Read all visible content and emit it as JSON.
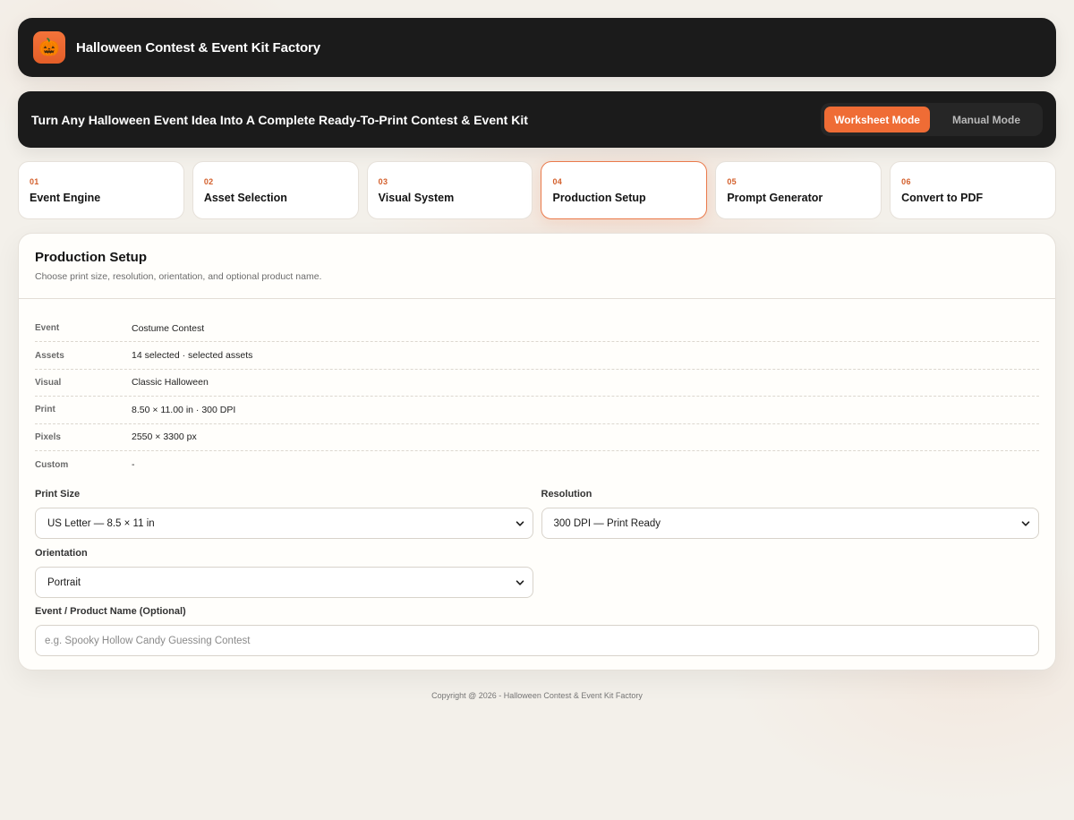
{
  "app": {
    "title": "Halloween Contest & Event Kit Factory",
    "logo_icon": "jack-o-lantern-icon",
    "logo_glyph": "🎃"
  },
  "banner": {
    "text": "Turn Any Halloween Event Idea Into A Complete Ready-To-Print Contest & Event Kit",
    "modes": [
      {
        "label": "Worksheet Mode",
        "active": true
      },
      {
        "label": "Manual Mode",
        "active": false
      }
    ]
  },
  "steps": [
    {
      "num": "01",
      "label": "Event Engine",
      "active": false
    },
    {
      "num": "02",
      "label": "Asset Selection",
      "active": false
    },
    {
      "num": "03",
      "label": "Visual System",
      "active": false
    },
    {
      "num": "04",
      "label": "Production Setup",
      "active": true
    },
    {
      "num": "05",
      "label": "Prompt Generator",
      "active": false
    },
    {
      "num": "06",
      "label": "Convert to PDF",
      "active": false
    }
  ],
  "card": {
    "title": "Production Setup",
    "subtitle": "Choose print size, resolution, orientation, and optional product name.",
    "summary": [
      {
        "label": "Event",
        "value": "Costume Contest"
      },
      {
        "label": "Assets",
        "value": "14 selected · selected assets"
      },
      {
        "label": "Visual",
        "value": "Classic Halloween"
      },
      {
        "label": "Print",
        "value": "8.50 × 11.00 in · 300 DPI"
      },
      {
        "label": "Pixels",
        "value": "2550 × 3300 px"
      },
      {
        "label": "Custom",
        "value": "-"
      }
    ],
    "form": {
      "print_size": {
        "label": "Print Size",
        "value": "US Letter — 8.5 × 11 in"
      },
      "resolution": {
        "label": "Resolution",
        "value": "300 DPI — Print Ready"
      },
      "orientation": {
        "label": "Orientation",
        "value": "Portrait"
      },
      "product_name": {
        "label": "Event / Product Name (Optional)",
        "value": "",
        "placeholder": "e.g. Spooky Hollow Candy Guessing Contest"
      }
    }
  },
  "footer": {
    "text": "Copyright @ 2026 - Halloween Contest & Event Kit Factory"
  },
  "colors": {
    "accent": "#ef6c35",
    "dark": "#1b1b1b",
    "background": "#f3f0ea"
  }
}
